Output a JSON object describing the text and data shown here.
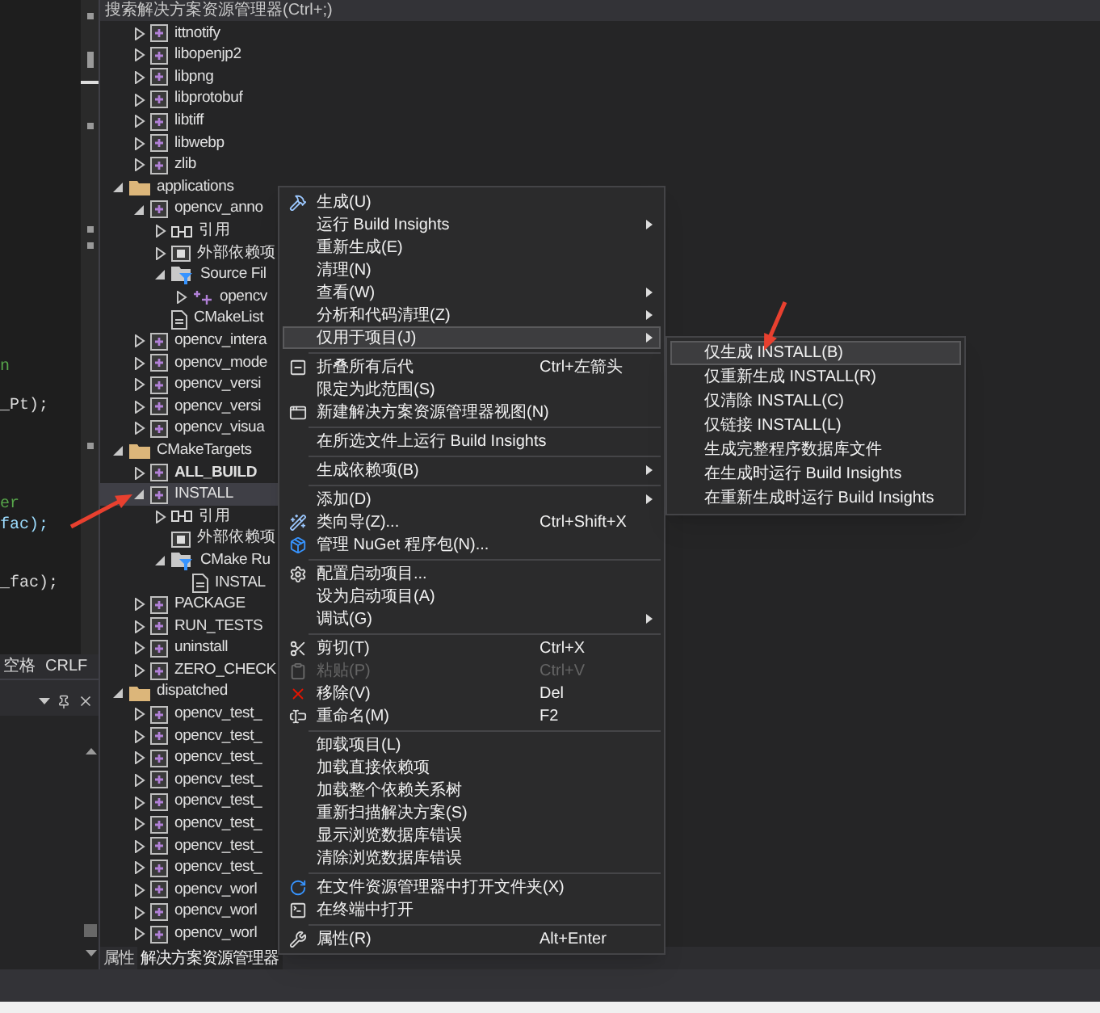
{
  "editor": {
    "code_lines": [
      {
        "text": "n",
        "color": "#57a64a"
      },
      {
        "text": "_Pt);",
        "color": "#dcdcdc"
      },
      {
        "text": "er",
        "color": "#57a64a"
      },
      {
        "text": "fac);",
        "color": "#9cdcfe"
      },
      {
        "text": "_fac);",
        "color": "#dcdcdc"
      }
    ],
    "status": {
      "indent": "空格",
      "line_ending": "CRLF"
    }
  },
  "explorer": {
    "search": {
      "placeholder": "搜索解决方案资源管理器(Ctrl+;)"
    },
    "tree_continued": [
      {
        "label": "ittnotify",
        "kind": "project",
        "expanded": false,
        "selected": false,
        "bold": false
      },
      {
        "label": "libopenjp2",
        "kind": "project",
        "expanded": false,
        "selected": false,
        "bold": false
      },
      {
        "label": "libpng",
        "kind": "project",
        "expanded": false,
        "selected": false,
        "bold": false
      },
      {
        "label": "libprotobuf",
        "kind": "project",
        "expanded": false,
        "selected": false,
        "bold": false
      },
      {
        "label": "libtiff",
        "kind": "project",
        "expanded": false,
        "selected": false,
        "bold": false
      },
      {
        "label": "libwebp",
        "kind": "project",
        "expanded": false,
        "selected": false,
        "bold": false
      },
      {
        "label": "zlib",
        "kind": "project",
        "expanded": false,
        "selected": false,
        "bold": false
      }
    ],
    "tree": [
      {
        "label": "applications",
        "kind": "folder",
        "expanded": true,
        "selected": false,
        "bold": false,
        "children": [
          {
            "label": "opencv_anno",
            "kind": "project",
            "expanded": true,
            "selected": false,
            "bold": false,
            "children": [
              {
                "label": "引用",
                "kind": "references",
                "expanded": false,
                "selected": false,
                "bold": false
              },
              {
                "label": "外部依赖项",
                "kind": "external",
                "expanded": false,
                "selected": false,
                "bold": false
              },
              {
                "label": "Source Fil",
                "kind": "filter",
                "expanded": true,
                "selected": false,
                "bold": false,
                "children": [
                  {
                    "label": "opencv",
                    "kind": "source",
                    "expanded": false,
                    "selected": false,
                    "bold": false
                  }
                ]
              },
              {
                "label": "CMakeList",
                "kind": "file",
                "selected": false,
                "bold": false
              }
            ]
          },
          {
            "label": "opencv_intera",
            "kind": "project",
            "expanded": false,
            "selected": false,
            "bold": false
          },
          {
            "label": "opencv_mode",
            "kind": "project",
            "expanded": false,
            "selected": false,
            "bold": false
          },
          {
            "label": "opencv_versi",
            "kind": "project",
            "expanded": false,
            "selected": false,
            "bold": false
          },
          {
            "label": "opencv_versi",
            "kind": "project",
            "expanded": false,
            "selected": false,
            "bold": false
          },
          {
            "label": "opencv_visua",
            "kind": "project",
            "expanded": false,
            "selected": false,
            "bold": false
          }
        ]
      },
      {
        "label": "CMakeTargets",
        "kind": "folder",
        "expanded": true,
        "selected": false,
        "bold": false,
        "children": [
          {
            "label": "ALL_BUILD",
            "kind": "project",
            "expanded": false,
            "selected": false,
            "bold": true
          },
          {
            "label": "INSTALL",
            "kind": "project",
            "expanded": true,
            "selected": true,
            "bold": false,
            "children": [
              {
                "label": "引用",
                "kind": "references",
                "expanded": false,
                "selected": false,
                "bold": false
              },
              {
                "label": "外部依赖项",
                "kind": "external",
                "selected": false,
                "bold": false
              },
              {
                "label": "CMake Ru",
                "kind": "filter",
                "expanded": true,
                "selected": false,
                "bold": false,
                "children": [
                  {
                    "label": "INSTAL",
                    "kind": "file",
                    "selected": false,
                    "bold": false
                  }
                ]
              }
            ]
          },
          {
            "label": "PACKAGE",
            "kind": "project",
            "expanded": false,
            "selected": false,
            "bold": false
          },
          {
            "label": "RUN_TESTS",
            "kind": "project",
            "expanded": false,
            "selected": false,
            "bold": false
          },
          {
            "label": "uninstall",
            "kind": "project",
            "expanded": false,
            "selected": false,
            "bold": false
          },
          {
            "label": "ZERO_CHECK",
            "kind": "project",
            "expanded": false,
            "selected": false,
            "bold": false
          }
        ]
      },
      {
        "label": "dispatched",
        "kind": "folder",
        "expanded": true,
        "selected": false,
        "bold": false,
        "children": [
          {
            "label": "opencv_test_",
            "kind": "project",
            "expanded": false,
            "selected": false,
            "bold": false
          },
          {
            "label": "opencv_test_",
            "kind": "project",
            "expanded": false,
            "selected": false,
            "bold": false
          },
          {
            "label": "opencv_test_",
            "kind": "project",
            "expanded": false,
            "selected": false,
            "bold": false
          },
          {
            "label": "opencv_test_",
            "kind": "project",
            "expanded": false,
            "selected": false,
            "bold": false
          },
          {
            "label": "opencv_test_",
            "kind": "project",
            "expanded": false,
            "selected": false,
            "bold": false
          },
          {
            "label": "opencv_test_",
            "kind": "project",
            "expanded": false,
            "selected": false,
            "bold": false
          },
          {
            "label": "opencv_test_",
            "kind": "project",
            "expanded": false,
            "selected": false,
            "bold": false
          },
          {
            "label": "opencv_test_",
            "kind": "project",
            "expanded": false,
            "selected": false,
            "bold": false
          },
          {
            "label": "opencv_worl",
            "kind": "project",
            "expanded": false,
            "selected": false,
            "bold": false
          },
          {
            "label": "opencv_worl",
            "kind": "project",
            "expanded": false,
            "selected": false,
            "bold": false
          },
          {
            "label": "opencv_worl",
            "kind": "project",
            "expanded": false,
            "selected": false,
            "bold": false
          }
        ]
      }
    ],
    "tabs": [
      {
        "label": "属性",
        "selected": false
      },
      {
        "label": "解决方案资源管理器",
        "selected": true
      }
    ]
  },
  "context_menu": {
    "items": [
      {
        "kind": "item",
        "label": "生成(U)",
        "submenu": false,
        "disabled": false,
        "selected": false
      },
      {
        "kind": "item",
        "label": "运行 Build Insights",
        "submenu": true,
        "disabled": false,
        "selected": false
      },
      {
        "kind": "item",
        "label": "重新生成(E)",
        "submenu": false,
        "disabled": false,
        "selected": false
      },
      {
        "kind": "item",
        "label": "清理(N)",
        "submenu": false,
        "disabled": false,
        "selected": false
      },
      {
        "kind": "item",
        "label": "查看(W)",
        "submenu": true,
        "disabled": false,
        "selected": false
      },
      {
        "kind": "item",
        "label": "分析和代码清理(Z)",
        "submenu": true,
        "disabled": false,
        "selected": false
      },
      {
        "kind": "item",
        "label": "仅用于项目(J)",
        "submenu": true,
        "disabled": false,
        "selected": true
      },
      {
        "kind": "separator"
      },
      {
        "kind": "item",
        "label": "折叠所有后代",
        "shortcut": "Ctrl+左箭头",
        "submenu": false,
        "disabled": false,
        "selected": false
      },
      {
        "kind": "item",
        "label": "限定为此范围(S)",
        "submenu": false,
        "disabled": false,
        "selected": false
      },
      {
        "kind": "item",
        "label": "新建解决方案资源管理器视图(N)",
        "submenu": false,
        "disabled": false,
        "selected": false
      },
      {
        "kind": "separator"
      },
      {
        "kind": "item",
        "label": "在所选文件上运行 Build Insights",
        "submenu": false,
        "disabled": false,
        "selected": false
      },
      {
        "kind": "separator"
      },
      {
        "kind": "item",
        "label": "生成依赖项(B)",
        "submenu": true,
        "disabled": false,
        "selected": false
      },
      {
        "kind": "separator"
      },
      {
        "kind": "item",
        "label": "添加(D)",
        "submenu": true,
        "disabled": false,
        "selected": false
      },
      {
        "kind": "item",
        "label": "类向导(Z)...",
        "shortcut": "Ctrl+Shift+X",
        "submenu": false,
        "disabled": false,
        "selected": false
      },
      {
        "kind": "item",
        "label": "管理 NuGet 程序包(N)...",
        "submenu": false,
        "disabled": false,
        "selected": false
      },
      {
        "kind": "separator"
      },
      {
        "kind": "item",
        "label": "配置启动项目...",
        "submenu": false,
        "disabled": false,
        "selected": false
      },
      {
        "kind": "item",
        "label": "设为启动项目(A)",
        "submenu": false,
        "disabled": false,
        "selected": false
      },
      {
        "kind": "item",
        "label": "调试(G)",
        "submenu": true,
        "disabled": false,
        "selected": false
      },
      {
        "kind": "separator"
      },
      {
        "kind": "item",
        "label": "剪切(T)",
        "shortcut": "Ctrl+X",
        "submenu": false,
        "disabled": false,
        "selected": false
      },
      {
        "kind": "item",
        "label": "粘贴(P)",
        "shortcut": "Ctrl+V",
        "submenu": false,
        "disabled": true,
        "selected": false
      },
      {
        "kind": "item",
        "label": "移除(V)",
        "shortcut": "Del",
        "submenu": false,
        "disabled": false,
        "selected": false
      },
      {
        "kind": "item",
        "label": "重命名(M)",
        "shortcut": "F2",
        "submenu": false,
        "disabled": false,
        "selected": false
      },
      {
        "kind": "separator"
      },
      {
        "kind": "item",
        "label": "卸载项目(L)",
        "submenu": false,
        "disabled": false,
        "selected": false
      },
      {
        "kind": "item",
        "label": "加载直接依赖项",
        "submenu": false,
        "disabled": false,
        "selected": false
      },
      {
        "kind": "item",
        "label": "加载整个依赖关系树",
        "submenu": false,
        "disabled": false,
        "selected": false
      },
      {
        "kind": "item",
        "label": "重新扫描解决方案(S)",
        "submenu": false,
        "disabled": false,
        "selected": false
      },
      {
        "kind": "item",
        "label": "显示浏览数据库错误",
        "submenu": false,
        "disabled": false,
        "selected": false
      },
      {
        "kind": "item",
        "label": "清除浏览数据库错误",
        "submenu": false,
        "disabled": false,
        "selected": false
      },
      {
        "kind": "separator"
      },
      {
        "kind": "item",
        "label": "在文件资源管理器中打开文件夹(X)",
        "submenu": false,
        "disabled": false,
        "selected": false
      },
      {
        "kind": "item",
        "label": "在终端中打开",
        "submenu": false,
        "disabled": false,
        "selected": false
      },
      {
        "kind": "separator"
      },
      {
        "kind": "item",
        "label": "属性(R)",
        "shortcut": "Alt+Enter",
        "submenu": false,
        "disabled": false,
        "selected": false
      }
    ]
  },
  "submenu": {
    "items": [
      {
        "label": "仅生成 INSTALL(B)",
        "selected": true
      },
      {
        "label": "仅重新生成 INSTALL(R)",
        "selected": false
      },
      {
        "label": "仅清除 INSTALL(C)",
        "selected": false
      },
      {
        "label": "仅链接 INSTALL(L)",
        "selected": false
      },
      {
        "label": "生成完整程序数据库文件",
        "selected": false
      },
      {
        "label": "在生成时运行 Build Insights",
        "selected": false
      },
      {
        "label": "在重新生成时运行 Build Insights",
        "selected": false
      }
    ]
  }
}
